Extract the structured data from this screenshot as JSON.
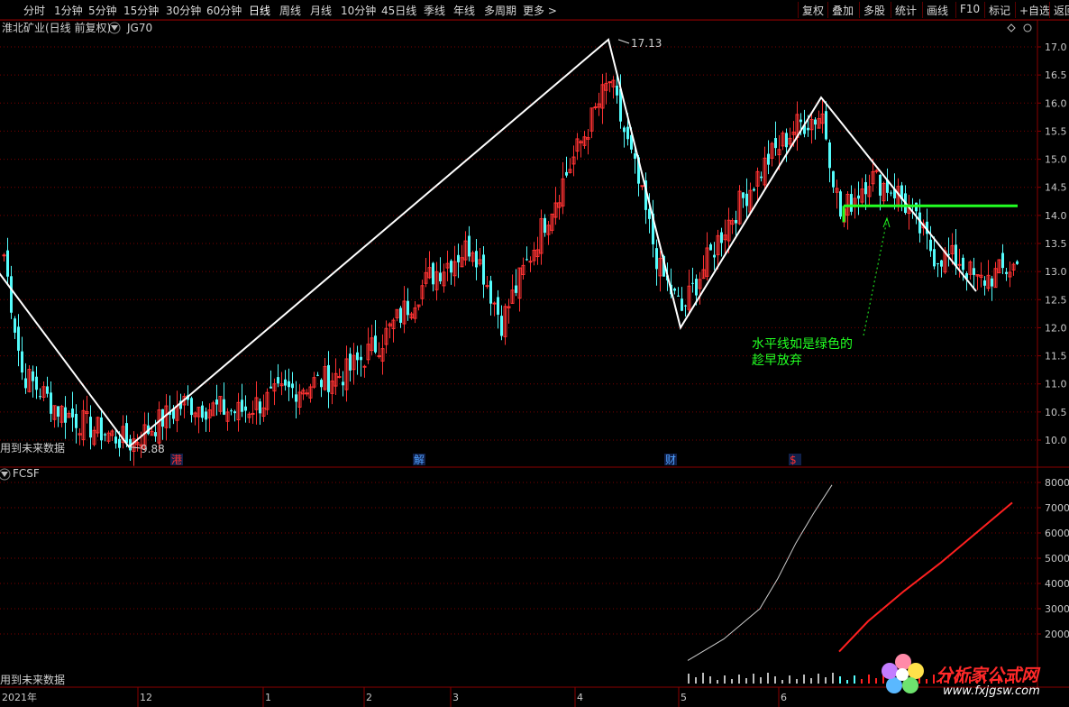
{
  "toolbar": {
    "left": [
      "分时",
      "1分钟",
      "5分钟",
      "15分钟",
      "30分钟",
      "60分钟",
      "日线",
      "周线",
      "月线",
      "10分钟",
      "45日线",
      "季线",
      "年线",
      "多周期",
      "更多 >"
    ],
    "active": "日线",
    "right": [
      "复权",
      "叠加",
      "多股",
      "统计",
      "画线",
      "F10",
      "标记",
      "+自选",
      "返回"
    ]
  },
  "main_panel": {
    "title": "淮北矿业(日线 前复权)",
    "indicator": "JG70",
    "future_note": "用到未来数据",
    "annotation_text_line1": "水平线如是绿色的",
    "annotation_text_line2": "趁早放弃",
    "high_label": "17.13",
    "low_label": "9.88",
    "event_markers": [
      "港",
      "解",
      "财",
      "$"
    ]
  },
  "sub_panel": {
    "indicator": "FCSF",
    "future_note": "用到未来数据"
  },
  "date_axis": {
    "year_label": "2021年",
    "month_labels": [
      "12",
      "1",
      "2",
      "3",
      "4",
      "5",
      "6"
    ]
  },
  "watermark": {
    "text": "分析家公式网",
    "url": "www.fxjgsw.com"
  },
  "colors": {
    "up": "#ff3232",
    "down": "#54fcfc",
    "zigzag": "#ffffff",
    "horizontal_line": "#22ff22",
    "annotation": "#22ff22",
    "grid": "#7a0000",
    "sub_white_line": "#cccccc",
    "sub_red_line": "#ff2020"
  },
  "chart_data": [
    {
      "type": "candlestick",
      "y_axis_ticks": [
        "17.0",
        "16.5",
        "16.0",
        "15.5",
        "15.0",
        "14.5",
        "14.0",
        "13.5",
        "13.0",
        "12.5",
        "12.0",
        "11.5",
        "11.0",
        "10.5",
        "10.0"
      ],
      "ylim": [
        9.8,
        17.35
      ],
      "zigzag_points": [
        {
          "i": -10,
          "price": 13.75
        },
        {
          "i": 35,
          "price": 9.88
        },
        {
          "i": 168,
          "price": 17.13
        },
        {
          "i": 188,
          "price": 12.0
        },
        {
          "i": 227,
          "price": 16.1
        },
        {
          "i": 270,
          "price": 12.65
        }
      ],
      "horizontal_line_price": 14.17,
      "bars_anchor_closes": [
        {
          "i": 0,
          "c": 13.3
        },
        {
          "i": 5,
          "c": 11.2
        },
        {
          "i": 15,
          "c": 10.55
        },
        {
          "i": 25,
          "c": 10.2
        },
        {
          "i": 35,
          "c": 9.95
        },
        {
          "i": 50,
          "c": 10.65
        },
        {
          "i": 65,
          "c": 10.5
        },
        {
          "i": 80,
          "c": 10.9
        },
        {
          "i": 95,
          "c": 11.2
        },
        {
          "i": 105,
          "c": 11.8
        },
        {
          "i": 118,
          "c": 12.9
        },
        {
          "i": 130,
          "c": 13.5
        },
        {
          "i": 138,
          "c": 12.1
        },
        {
          "i": 150,
          "c": 13.9
        },
        {
          "i": 160,
          "c": 15.3
        },
        {
          "i": 168,
          "c": 16.4
        },
        {
          "i": 175,
          "c": 14.8
        },
        {
          "i": 182,
          "c": 13.0
        },
        {
          "i": 188,
          "c": 12.3
        },
        {
          "i": 200,
          "c": 13.8
        },
        {
          "i": 212,
          "c": 15.0
        },
        {
          "i": 220,
          "c": 15.6
        },
        {
          "i": 227,
          "c": 15.8
        },
        {
          "i": 232,
          "c": 14.0
        },
        {
          "i": 240,
          "c": 14.7
        },
        {
          "i": 248,
          "c": 14.4
        },
        {
          "i": 258,
          "c": 13.3
        },
        {
          "i": 265,
          "c": 13.2
        },
        {
          "i": 270,
          "c": 12.8
        },
        {
          "i": 280,
          "c": 13.1
        }
      ]
    },
    {
      "type": "line",
      "y_axis_ticks": [
        "8000",
        "7000",
        "6000",
        "5000",
        "4000",
        "3000",
        "2000"
      ],
      "ylim": [
        900,
        8300
      ],
      "series": [
        {
          "color": "white",
          "x": [
            190,
            200,
            210,
            215,
            220,
            225,
            230
          ],
          "y": [
            950,
            1800,
            3000,
            4200,
            5600,
            6800,
            7900
          ]
        },
        {
          "color": "red",
          "x": [
            232,
            240,
            250,
            260,
            270,
            280
          ],
          "y": [
            1300,
            2500,
            3700,
            4800,
            6000,
            7200
          ]
        }
      ]
    }
  ]
}
